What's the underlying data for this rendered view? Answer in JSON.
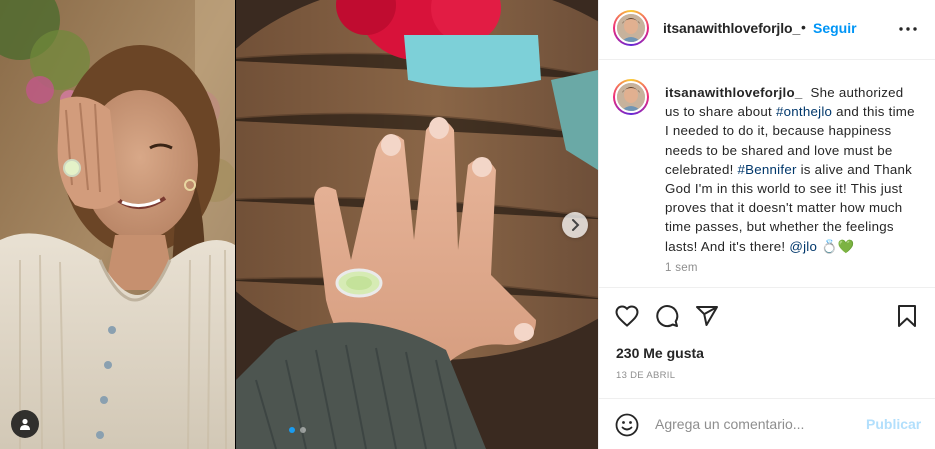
{
  "post": {
    "username": "itsanawithloveforjlo_",
    "follow_label": "Seguir",
    "separator": "•",
    "caption": {
      "username": "itsanawithloveforjlo_",
      "part1": "She authorized us to share about ",
      "tag1": "#onthejlo",
      "part2": " and this time I needed to do it, because happiness needs to be shared and love must be celebrated! ",
      "tag2": "#Bennifer",
      "part3": " is alive and Thank God I'm in this world to see it! This just proves that it doesn't matter how much time passes, but whether the feelings lasts! And it's there! ",
      "mention": "@jlo",
      "emoji": "💍💚"
    },
    "time_ago": "1 sem",
    "likes": "230 Me gusta",
    "date": "13 DE ABRIL",
    "comment_placeholder": "Agrega un comentario...",
    "publish_label": "Publicar"
  },
  "carousel": {
    "current_index": 1,
    "total": 2
  },
  "icons": {
    "more": "more-options-icon",
    "like": "heart-icon",
    "comment": "comment-icon",
    "share": "paper-plane-icon",
    "save": "bookmark-icon",
    "emoji": "smiley-icon",
    "next": "chevron-right-icon",
    "user_tag": "user-tag-icon"
  },
  "colors": {
    "accent": "#0095f6",
    "publish_disabled": "#b2dffc",
    "hashtag": "#00376b",
    "muted": "#8e8e8e"
  }
}
